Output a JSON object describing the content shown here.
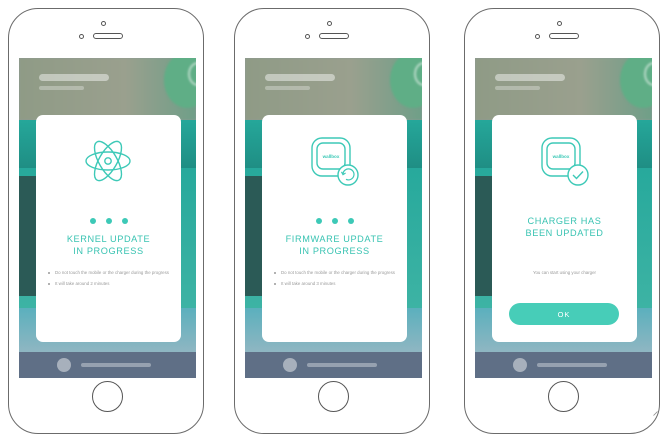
{
  "colors": {
    "accent": "#3dc9b7",
    "button": "#47cdb8",
    "body_text": "#9a9a9a",
    "card_bg": "#ffffff"
  },
  "screens": [
    {
      "icon": "atom-icon",
      "title": "KERNEL UPDATE\nIN PROGRESS",
      "bullets": [
        "Do not touch the mobile or the charger during the progress",
        "It will take around 2 minutes"
      ]
    },
    {
      "icon": "charger-refresh-icon",
      "logo_text": "wallbox",
      "title": "FIRMWARE UPDATE\nIN PROGRESS",
      "bullets": [
        "Do not touch the mobile or the charger during the progress",
        "It will take around 3 minutes"
      ]
    },
    {
      "icon": "charger-check-icon",
      "logo_text": "wallbox",
      "title": "CHARGER HAS\nBEEN UPDATED",
      "message": "You can start using your charger",
      "button_label": "OK"
    }
  ]
}
